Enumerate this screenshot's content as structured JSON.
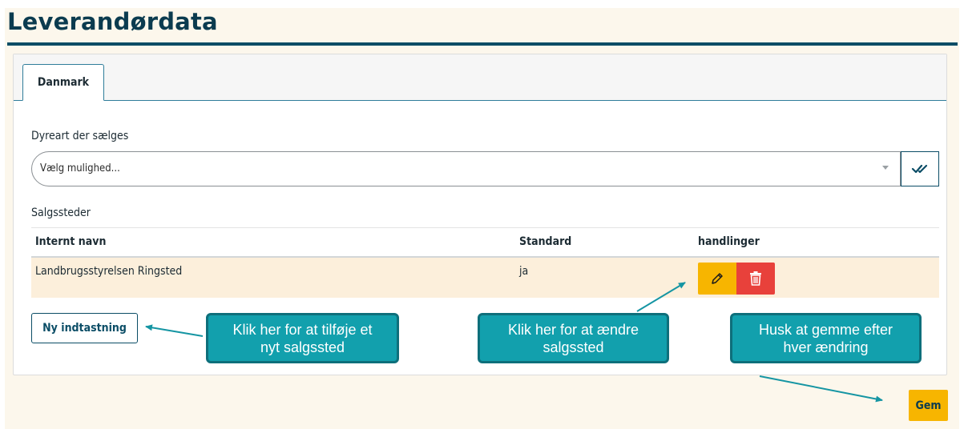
{
  "page": {
    "title": "Leverandørdata"
  },
  "tabs": [
    {
      "label": "Danmark",
      "active": true
    }
  ],
  "animal_select": {
    "label": "Dyreart der sælges",
    "placeholder": "Vælg mulighed...",
    "confirm_icon": "double-check-icon"
  },
  "sales_locations": {
    "label": "Salgssteder",
    "columns": [
      "Internt navn",
      "Standard",
      "handlinger"
    ],
    "rows": [
      {
        "name": "Landbrugsstyrelsen Ringsted",
        "standard": "ja",
        "actions": [
          "pencil-icon",
          "trash-icon"
        ]
      }
    ]
  },
  "buttons": {
    "new_entry": "Ny indtastning",
    "save": "Gem"
  },
  "callouts": {
    "add": [
      "Klik her for at tilføje et",
      "nyt salgssted"
    ],
    "edit": [
      "Klik her for at ændre",
      "salgssted"
    ],
    "save": [
      "Husk at gemme efter",
      "hver ændring"
    ]
  },
  "colors": {
    "brand": "#0b4d66",
    "edit": "#f7b500",
    "delete": "#e8413b",
    "callout": "#12a0ad",
    "row_highlight": "#fcefdb"
  }
}
